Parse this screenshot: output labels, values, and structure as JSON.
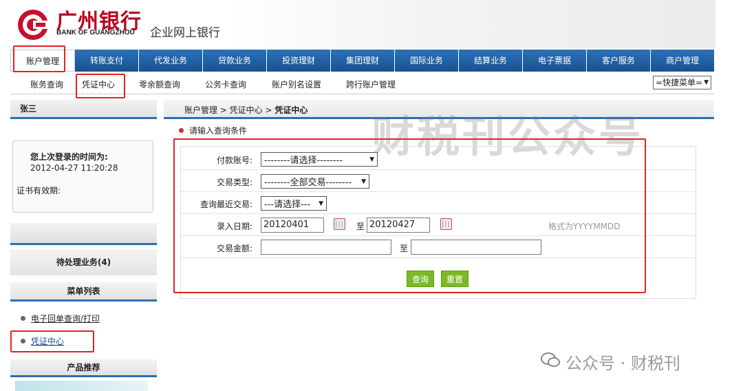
{
  "header": {
    "bank_name_cn": "广州银行",
    "bank_name_en": "BANK OF GUANGZHOU",
    "subtitle": "企业网上银行",
    "brand_color": "#b8001e"
  },
  "main_nav": [
    {
      "label": "账户管理",
      "active": true
    },
    {
      "label": "转账支付"
    },
    {
      "label": "代发业务"
    },
    {
      "label": "贷款业务"
    },
    {
      "label": "投资理财"
    },
    {
      "label": "集团理财"
    },
    {
      "label": "国际业务"
    },
    {
      "label": "结算业务"
    },
    {
      "label": "电子票据"
    },
    {
      "label": "客户服务"
    },
    {
      "label": "商户管理"
    }
  ],
  "sub_nav": {
    "items": [
      "账务查询",
      "凭证中心",
      "零余额查询",
      "公务卡查询",
      "账户别名设置",
      "跨行账户管理"
    ],
    "active": "凭证中心",
    "quick_menu": "=快捷菜单="
  },
  "sidebar": {
    "user_name": "张三",
    "last_login_label": "您上次登录的时间为:",
    "last_login_time": "2012-04-27 11:20:28",
    "cert_valid_label": "证书有效期:",
    "pending": "待处理业务(4)",
    "menu_title": "菜单列表",
    "menu_items": [
      "电子回单查询/打印",
      "凭证中心"
    ],
    "products_title": "产品推荐"
  },
  "main": {
    "breadcrumb": {
      "path": "账户管理 > 凭证中心 > ",
      "current": "凭证中心"
    },
    "condition_title": "请输入查询条件",
    "form": {
      "pay_account_label": "付款账号:",
      "pay_account_value": "--------请选择--------",
      "trade_type_label": "交易类型:",
      "trade_type_value": "--------全部交易--------",
      "recent_label": "查询最近交易:",
      "recent_value": "---请选择---",
      "date_label": "录入日期:",
      "date_from": "20120401",
      "date_sep": "至",
      "date_to": "20120427",
      "date_hint": "格式为YYYYMMDD",
      "amount_label": "交易金额:",
      "amount_from": "",
      "amount_sep": "至",
      "amount_to": ""
    },
    "buttons": {
      "query": "查询",
      "reset": "重置"
    }
  },
  "watermarks": {
    "big": "财税刊公众号",
    "small": "公众号 · 财税刊"
  },
  "colors": {
    "nav_blue": "#1d5fa0",
    "highlight_red": "#e02323",
    "button_green": "#7cb929"
  }
}
